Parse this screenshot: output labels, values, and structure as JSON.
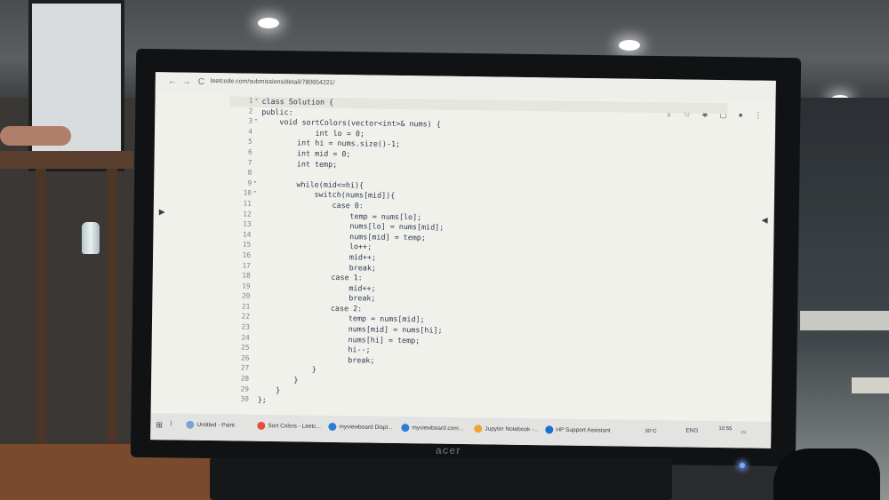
{
  "browser": {
    "url": "leetcode.com/submissions/detail/780654221/",
    "nav_back": "←",
    "nav_forward": "→",
    "nav_reload": "C"
  },
  "toolbar_icons": [
    "share-icon",
    "star-icon",
    "extension-icon",
    "window-icon",
    "profile-icon",
    "menu-icon"
  ],
  "code_lines": [
    {
      "n": "1",
      "fold": "▾",
      "text": "class Solution {"
    },
    {
      "n": "2",
      "fold": "",
      "text": "public:"
    },
    {
      "n": "3",
      "fold": "▾",
      "text": "    void sortColors(vector<int>& nums) {"
    },
    {
      "n": "4",
      "fold": "",
      "text": "            int lo = 0;"
    },
    {
      "n": "5",
      "fold": "",
      "text": "        int hi = nums.size()-1;"
    },
    {
      "n": "6",
      "fold": "",
      "text": "        int mid = 0;"
    },
    {
      "n": "7",
      "fold": "",
      "text": "        int temp;"
    },
    {
      "n": "8",
      "fold": "",
      "text": ""
    },
    {
      "n": "9",
      "fold": "▾",
      "text": "        while(mid<=hi){"
    },
    {
      "n": "10",
      "fold": "▾",
      "text": "            switch(nums[mid]){"
    },
    {
      "n": "11",
      "fold": "",
      "text": "                case 0:"
    },
    {
      "n": "12",
      "fold": "",
      "text": "                    temp = nums[lo];"
    },
    {
      "n": "13",
      "fold": "",
      "text": "                    nums[lo] = nums[mid];"
    },
    {
      "n": "14",
      "fold": "",
      "text": "                    nums[mid] = temp;"
    },
    {
      "n": "15",
      "fold": "",
      "text": "                    lo++;"
    },
    {
      "n": "16",
      "fold": "",
      "text": "                    mid++;"
    },
    {
      "n": "17",
      "fold": "",
      "text": "                    break;"
    },
    {
      "n": "18",
      "fold": "",
      "text": "                case 1:"
    },
    {
      "n": "19",
      "fold": "",
      "text": "                    mid++;"
    },
    {
      "n": "20",
      "fold": "",
      "text": "                    break;"
    },
    {
      "n": "21",
      "fold": "",
      "text": "                case 2:"
    },
    {
      "n": "22",
      "fold": "",
      "text": "                    temp = nums[mid];"
    },
    {
      "n": "23",
      "fold": "",
      "text": "                    nums[mid] = nums[hi];"
    },
    {
      "n": "24",
      "fold": "",
      "text": "                    nums[hi] = temp;"
    },
    {
      "n": "25",
      "fold": "",
      "text": "                    hi--;"
    },
    {
      "n": "26",
      "fold": "",
      "text": "                    break;"
    },
    {
      "n": "27",
      "fold": "",
      "text": "            }"
    },
    {
      "n": "28",
      "fold": "",
      "text": "        }"
    },
    {
      "n": "29",
      "fold": "",
      "text": "    }"
    },
    {
      "n": "30",
      "fold": "",
      "text": "};"
    }
  ],
  "taskbar": {
    "items": [
      {
        "label": "Untitled - Paint",
        "color": "#7aa3d6"
      },
      {
        "label": "Sort Colors - Leetc...",
        "color": "#e4513b"
      },
      {
        "label": "myviewboard Displ...",
        "color": "#2f7cd6"
      },
      {
        "label": "myviewboard.com...",
        "color": "#2f7cd6"
      },
      {
        "label": "Jupyter Notebook -...",
        "color": "#f0a52c"
      },
      {
        "label": "HP Support Assistant",
        "color": "#1b6fd0"
      }
    ],
    "weather": "30°C",
    "language": "ENG",
    "time": "10:55"
  },
  "monitor_brand": "acer"
}
